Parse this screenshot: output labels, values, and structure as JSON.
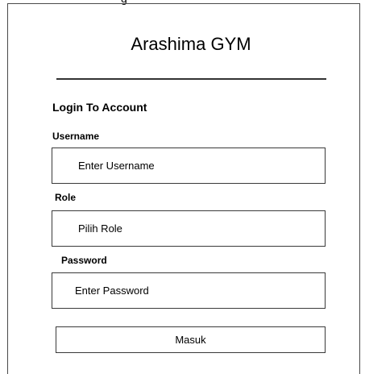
{
  "page": {
    "top_fragment": "g"
  },
  "header": {
    "title": "Arashima GYM"
  },
  "form": {
    "heading": "Login To Account",
    "username": {
      "label": "Username",
      "placeholder": "Enter Username"
    },
    "role": {
      "label": "Role",
      "placeholder": "Pilih Role"
    },
    "password": {
      "label": "Password",
      "placeholder": "Enter Password"
    },
    "submit_label": "Masuk"
  }
}
